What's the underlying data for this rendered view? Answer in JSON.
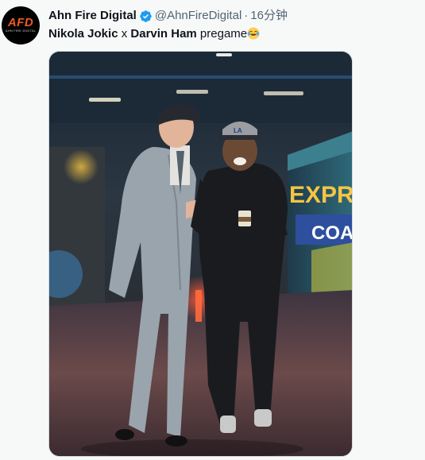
{
  "author": {
    "avatar_logo": "AFD",
    "avatar_sub": "AHN FIRE DIGITAL",
    "name": "Ahn Fire Digital",
    "verified_icon": "verified-badge-icon",
    "handle": "@AhnFireDigital",
    "separator": "·",
    "timestamp": "16分钟"
  },
  "tweet": {
    "text_parts": {
      "name1": "Nikola Jokic",
      "mid": " x ",
      "name2": "Darvin Ham",
      "tail": " pregame"
    },
    "emoji_icon": "laughing-tears-emoji-icon"
  },
  "media": {
    "bus_text_1": "EXPRE",
    "bus_text_2": "COACH",
    "cap_logo": "LA"
  },
  "colors": {
    "verified_blue": "#1d9bf0",
    "secondary_text": "#536471",
    "avatar_orange": "#f15a22"
  }
}
